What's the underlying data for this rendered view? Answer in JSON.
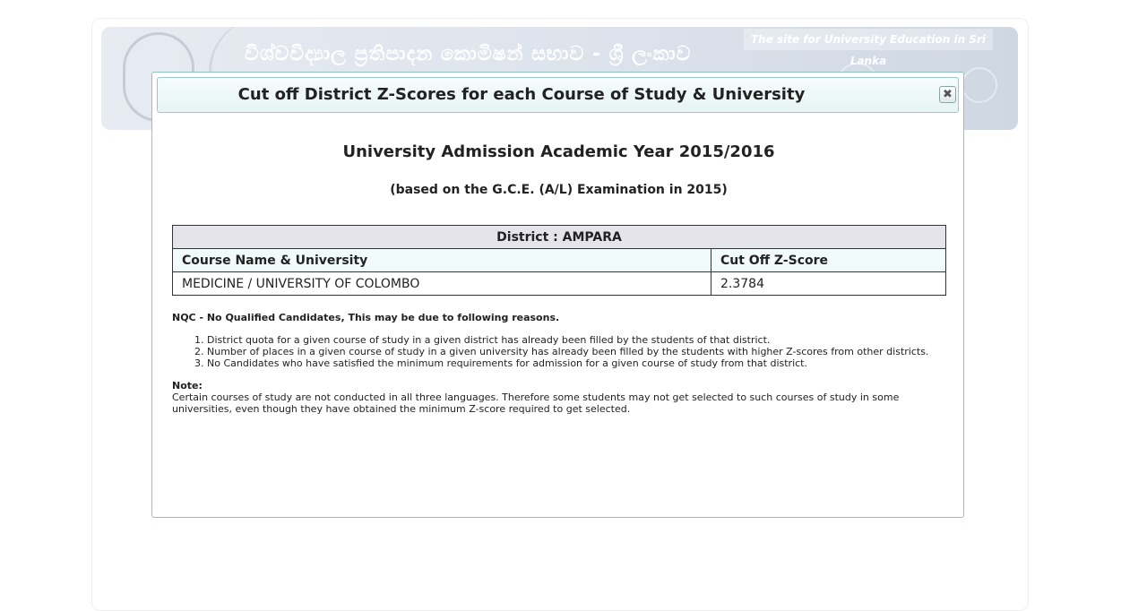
{
  "banner": {
    "sinhala_title": "විශ්වවිද්‍යාල ප්‍රතිපාදන කොමිෂන් සභාව - ශ්‍රී ලංකාව",
    "tagline": "The site for University Education in Sri Lanka"
  },
  "modal": {
    "title": "Cut off District Z-Scores for each Course of Study & University",
    "close_label": "✖",
    "heading": "University Admission Academic Year 2015/2016",
    "subheading": "(based on the G.C.E. (A/L) Examination in 2015)"
  },
  "table": {
    "district_label": "District : AMPARA",
    "columns": [
      "Course Name & University",
      "Cut Off Z-Score"
    ],
    "rows": [
      {
        "course": "MEDICINE / UNIVERSITY OF COLOMBO",
        "zscore": "2.3784"
      }
    ]
  },
  "notes": {
    "nqc_heading": "NQC - No Qualified Candidates, This may be due to following reasons.",
    "reasons": [
      "District quota for a given course of study in a given district has already been filled by the students of that district.",
      "Number of places in a given course of study in a given university has already been filled by the students with higher Z-scores from other districts.",
      "No Candidates who have satisfied the minimum requirements for admission for a given course of study from that district."
    ],
    "note_label": "Note:",
    "note_text": "Certain courses of study are not conducted in all three languages. Therefore some students may not get selected to such courses of study in some universities, even though they have obtained the minimum Z-score required to get selected."
  },
  "colors": {
    "modal_border": "#8ec3c0",
    "titlebar_bg": "#e6f4f4",
    "district_row_bg": "#e5e4ea",
    "header_row_bg": "#f2fbfb"
  },
  "icons": {
    "close": "close-icon",
    "crest": "emblem-icon"
  }
}
